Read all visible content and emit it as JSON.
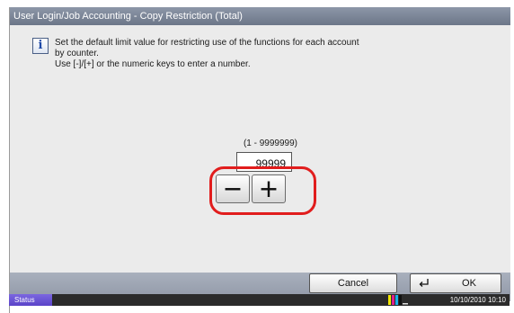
{
  "window": {
    "title": "User Login/Job Accounting - Copy Restriction (Total)"
  },
  "info": {
    "icon": "info-icon",
    "lines": [
      "Set the default limit value for restricting use of the functions for each account",
      "by counter.",
      "Use [-]/[+] or the numeric keys to enter a number."
    ]
  },
  "limit": {
    "range_label": "(1 - 9999999)",
    "value": "99999"
  },
  "stepper": {
    "minus_icon": "minus-icon",
    "plus_icon": "plus-icon",
    "highlight_color": "#e11d1d"
  },
  "footer": {
    "cancel_label": "Cancel",
    "ok_label": "OK",
    "ok_icon": "enter-icon"
  },
  "status": {
    "button_label": "Status",
    "toner_icon": "toner-icon",
    "datetime": "10/10/2010  10:10"
  }
}
